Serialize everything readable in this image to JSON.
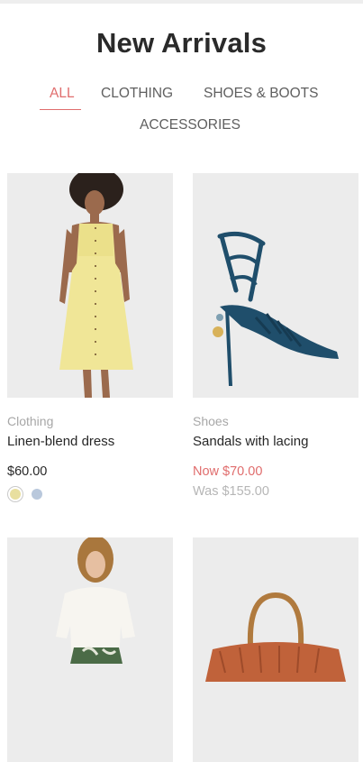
{
  "header": {
    "title": "New Arrivals"
  },
  "tabs": [
    {
      "label": "ALL",
      "active": true
    },
    {
      "label": "CLOTHING",
      "active": false
    },
    {
      "label": "SHOES & BOOTS",
      "active": false
    },
    {
      "label": "ACCESSORIES",
      "active": false
    }
  ],
  "products": [
    {
      "category": "Clothing",
      "name": "Linen-blend dress",
      "price": "$60.00",
      "swatches": [
        {
          "color": "#e8df9f",
          "selected": true
        },
        {
          "color": "#b9c8dc",
          "selected": false
        }
      ],
      "image": "yellow-dress-photo"
    },
    {
      "category": "Shoes",
      "name": "Sandals with lacing",
      "price_now": "Now $70.00",
      "price_was": "Was $155.00",
      "image": "blue-lace-sandal-photo"
    },
    {
      "image": "white-top-floral-shorts-photo"
    },
    {
      "image": "woven-basket-bag-photo"
    }
  ],
  "colors": {
    "accent": "#e06d6d",
    "tile_background": "#ececec",
    "muted_text": "#a7a7a7"
  }
}
